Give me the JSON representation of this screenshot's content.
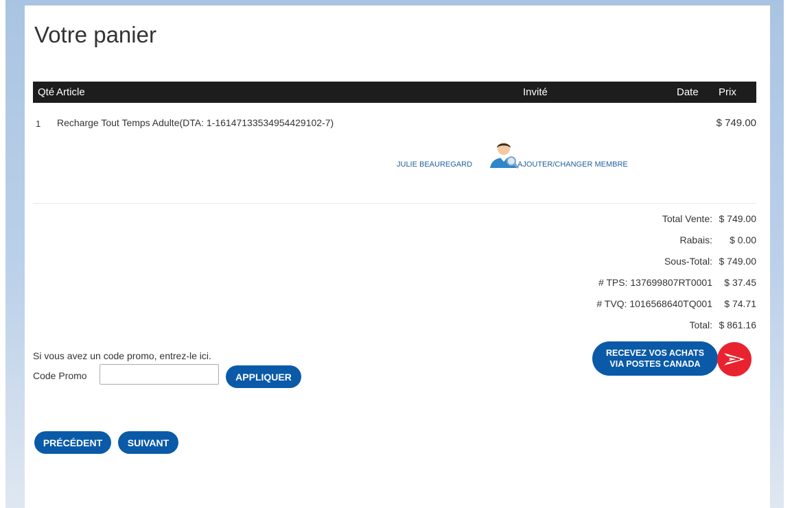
{
  "page": {
    "title": "Votre panier"
  },
  "table": {
    "headers": {
      "qty": "Qté",
      "article": "Article",
      "guest": "Invité",
      "date": "Date",
      "price": "Prix"
    },
    "rows": [
      {
        "qty": "1",
        "article": "Recharge Tout Temps Adulte(DTA: 1-16147133534954429102-7)",
        "date": "",
        "price": "$ 749.00"
      }
    ]
  },
  "guest": {
    "name": "JULIE BEAUREGARD",
    "icon": "user-search-icon",
    "link_label": "AJOUTER/CHANGER MEMBRE"
  },
  "totals": [
    {
      "label": "Total Vente:",
      "value": "$ 749.00"
    },
    {
      "label": "Rabais:",
      "value": "$ 0.00"
    },
    {
      "label": "Sous-Total:",
      "value": "$ 749.00"
    },
    {
      "label": "# TPS: 137699807RT0001",
      "value": "$ 37.45"
    },
    {
      "label": "# TVQ: 1016568640TQ001",
      "value": "$ 74.71"
    },
    {
      "label": "Total:",
      "value": "$ 861.16"
    }
  ],
  "promo": {
    "prompt": "Si vous avez un code promo, entrez-le ici.",
    "label": "Code Promo",
    "input_value": "",
    "apply_label": "APPLIQUER"
  },
  "postes": {
    "line1": "RECEVEZ VOS ACHATS",
    "line2": "VIA POSTES CANADA",
    "logo_icon": "postes-canada-logo"
  },
  "nav": {
    "prev_label": "PRÉCÉDENT",
    "next_label": "SUIVANT"
  },
  "colors": {
    "accent": "#0a5aa8",
    "header_bg": "#1d1d1d",
    "link": "#1f5f9f",
    "postes_red": "#e8232f"
  }
}
